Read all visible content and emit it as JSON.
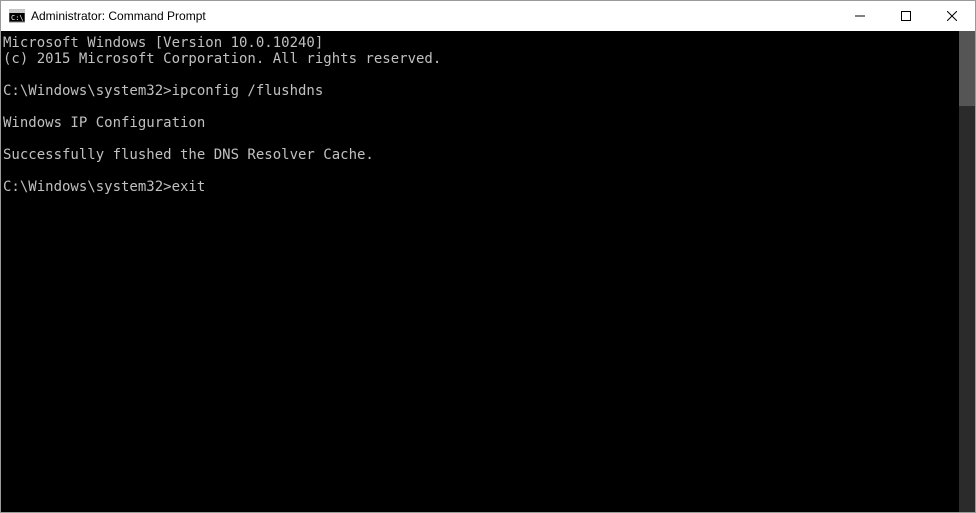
{
  "titlebar": {
    "title": "Administrator: Command Prompt"
  },
  "terminal": {
    "lines": [
      "Microsoft Windows [Version 10.0.10240]",
      "(c) 2015 Microsoft Corporation. All rights reserved.",
      "",
      "C:\\Windows\\system32>ipconfig /flushdns",
      "",
      "Windows IP Configuration",
      "",
      "Successfully flushed the DNS Resolver Cache.",
      "",
      "C:\\Windows\\system32>exit"
    ]
  }
}
